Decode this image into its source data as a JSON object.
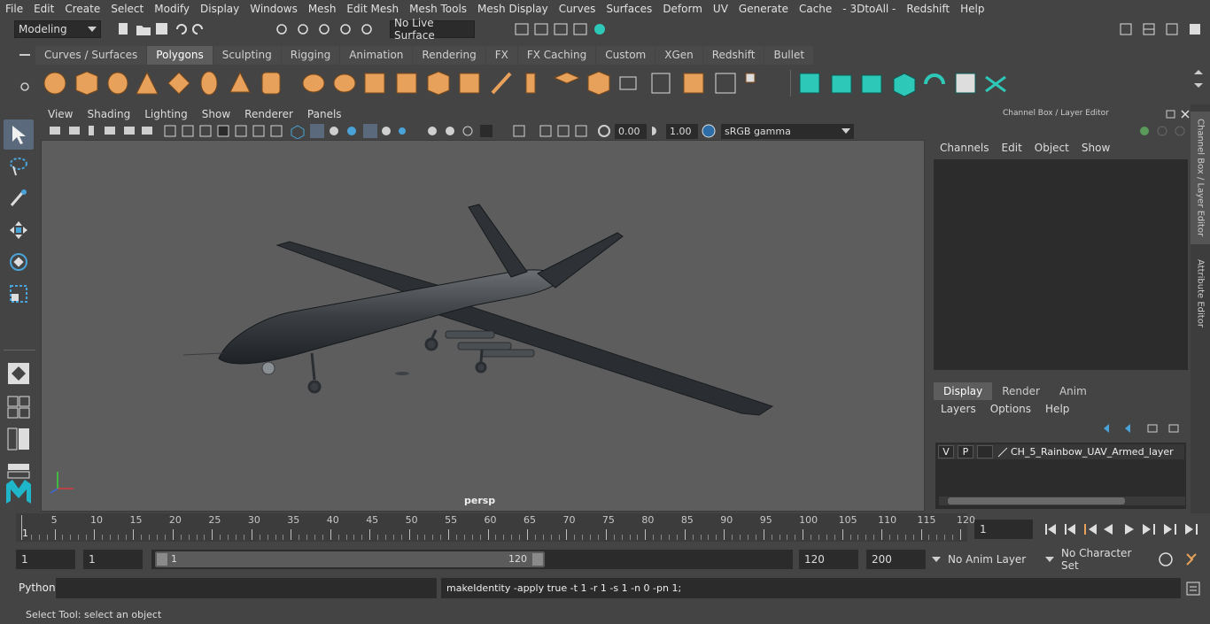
{
  "menubar": [
    "File",
    "Edit",
    "Create",
    "Select",
    "Modify",
    "Display",
    "Windows",
    "Mesh",
    "Edit Mesh",
    "Mesh Tools",
    "Mesh Display",
    "Curves",
    "Surfaces",
    "Deform",
    "UV",
    "Generate",
    "Cache",
    "- 3DtoAll -",
    "Redshift",
    "Help"
  ],
  "status": {
    "mode": "Modeling",
    "live_surface": "No Live Surface"
  },
  "shelf_tabs": [
    "Curves / Surfaces",
    "Polygons",
    "Sculpting",
    "Rigging",
    "Animation",
    "Rendering",
    "FX",
    "FX Caching",
    "Custom",
    "XGen",
    "Redshift",
    "Bullet"
  ],
  "panel_menu": [
    "View",
    "Shading",
    "Lighting",
    "Show",
    "Renderer",
    "Panels"
  ],
  "panel_tools": {
    "exposure": "0.00",
    "gamma": "1.00",
    "color_space": "sRGB gamma"
  },
  "viewport": {
    "camera_label": "persp"
  },
  "channel_box": {
    "title": "Channel Box / Layer Editor",
    "menu": [
      "Channels",
      "Edit",
      "Object",
      "Show"
    ]
  },
  "layer_editor": {
    "tabs": [
      "Display",
      "Render",
      "Anim"
    ],
    "menu": [
      "Layers",
      "Options",
      "Help"
    ],
    "layer": {
      "v": "V",
      "p": "P",
      "name": "CH_5_Rainbow_UAV_Armed_layer"
    }
  },
  "side_tabs": [
    "Channel Box / Layer Editor",
    "Attribute Editor"
  ],
  "timeline": {
    "ticks": [
      "5",
      "10",
      "15",
      "20",
      "25",
      "30",
      "35",
      "40",
      "45",
      "50",
      "55",
      "60",
      "65",
      "70",
      "75",
      "80",
      "85",
      "90",
      "95",
      "100",
      "105",
      "110",
      "115",
      "120"
    ],
    "current_marker": "1",
    "current_frame": "1"
  },
  "range": {
    "start": "1",
    "inner_start": "1",
    "slider_start": "1",
    "slider_end": "120",
    "end": "120",
    "anim_end": "200",
    "anim_layer": "No Anim Layer",
    "character_set": "No Character Set"
  },
  "command": {
    "lang": "Python",
    "result": "makeIdentity -apply true -t 1 -r 1 -s 1 -n 0 -pn 1;"
  },
  "help_line": "Select Tool: select an object",
  "colors": {
    "accent_orange": "#e8a15a",
    "accent_teal": "#2ec8b8",
    "viewport_bg": "#5d5d5d"
  }
}
